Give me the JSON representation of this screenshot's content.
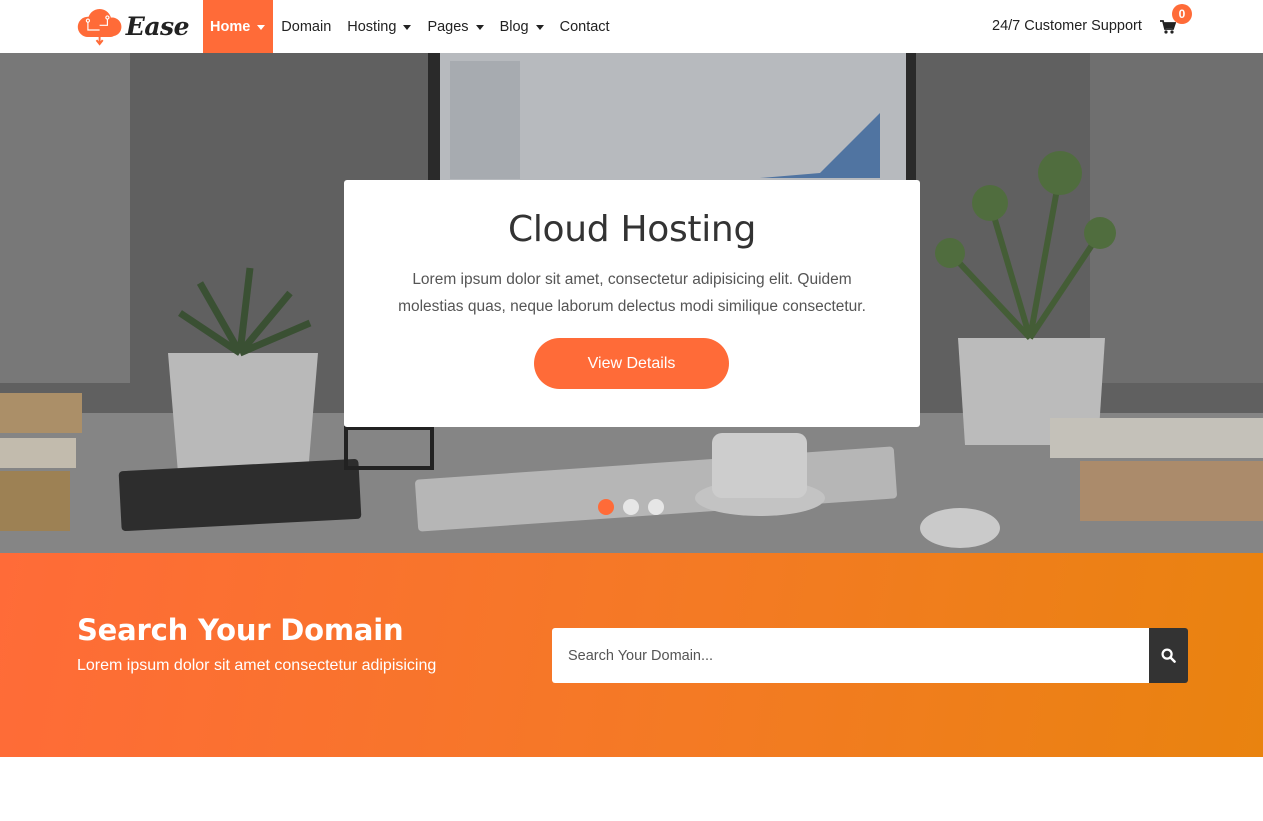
{
  "brand": {
    "name": "Ease",
    "accent": "#ff6b38"
  },
  "nav": {
    "items": [
      {
        "label": "Home",
        "dropdown": true,
        "active": true
      },
      {
        "label": "Domain",
        "dropdown": false
      },
      {
        "label": "Hosting",
        "dropdown": true
      },
      {
        "label": "Pages",
        "dropdown": true
      },
      {
        "label": "Blog",
        "dropdown": true
      },
      {
        "label": "Contact",
        "dropdown": false
      }
    ],
    "support": "24/7 Customer Support",
    "cart_count": "0",
    "cart_icon": "cart-icon"
  },
  "hero": {
    "title": "Cloud Hosting",
    "text": "Lorem ipsum dolor sit amet, consectetur adipisicing elit. Quidem molestias quas, neque laborum delectus modi similique consectetur.",
    "button_label": "View Details",
    "slides": 3,
    "active_slide": 1
  },
  "search": {
    "title": "Search Your Domain",
    "subtitle": "Lorem ipsum dolor sit amet consectetur adipisicing",
    "placeholder": "Search Your Domain...",
    "button_icon": "search-icon"
  }
}
